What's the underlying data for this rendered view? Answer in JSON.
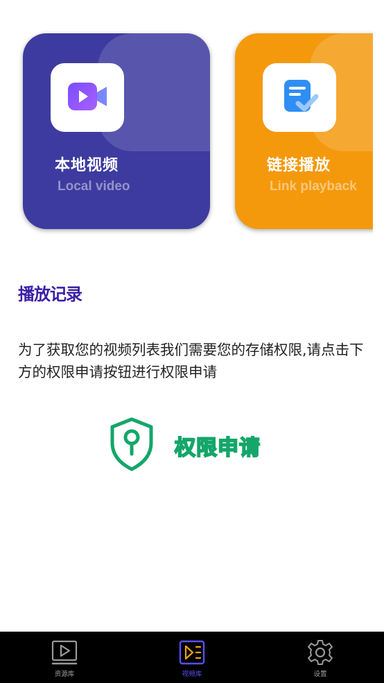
{
  "cards": [
    {
      "id": "local",
      "title": "本地视频",
      "subtitle": "Local video",
      "icon": "video-camera-icon",
      "color": "#3d3b9f"
    },
    {
      "id": "link",
      "title": "链接播放",
      "subtitle": "Link playback",
      "icon": "document-check-icon",
      "color": "#f4990c"
    }
  ],
  "history": {
    "title": "播放记录",
    "title_color": "#3a1fa5",
    "underline_color": "#e8102c"
  },
  "permission": {
    "message": "为了获取您的视频列表我们需要您的存储权限,请点击下方的权限申请按钮进行权限申请",
    "button_label": "权限申请",
    "button_icon": "shield-key-icon",
    "accent_color": "#14a66a"
  },
  "tabbar": {
    "active_color": "#5b4ff5",
    "tabs": [
      {
        "label": "资源库",
        "icon": "play-screen-icon",
        "active": false
      },
      {
        "label": "视频库",
        "icon": "video-list-icon",
        "active": true
      },
      {
        "label": "设置",
        "icon": "gear-icon",
        "active": false
      }
    ]
  }
}
